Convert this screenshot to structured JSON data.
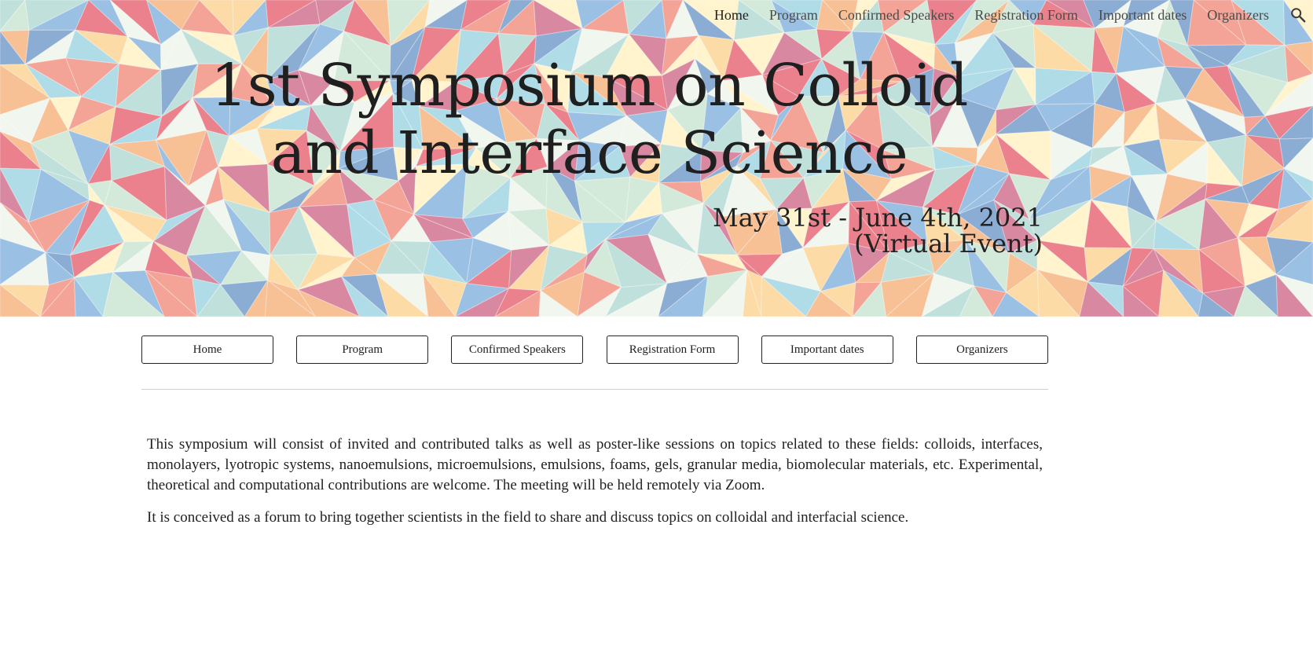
{
  "nav": {
    "links": [
      "Home",
      "Program",
      "Confirmed Speakers",
      "Registration Form",
      "Important dates",
      "Organizers"
    ],
    "active": "Home",
    "search_icon": "search-icon"
  },
  "hero": {
    "title_line1": "1st Symposium on Colloid",
    "title_line2": "and Interface Science",
    "dates_line1": "May 31st - June 4th, 2021",
    "dates_line2": "(Virtual Event)",
    "palette": [
      "#e8737f",
      "#f29a8c",
      "#f7b98a",
      "#fcd79c",
      "#fff3c9",
      "#cfe8d6",
      "#a8d8e6",
      "#8fb9e0",
      "#7ea3cf",
      "#d47b96",
      "#f0f7ee",
      "#b9ddd9"
    ]
  },
  "buttons": [
    "Home",
    "Program",
    "Confirmed Speakers",
    "Registration Form",
    "Important dates",
    "Organizers"
  ],
  "content": {
    "paragraph1": "This symposium will consist of invited and contributed talks as well as poster-like sessions on topics related to these fields: colloids, interfaces, monolayers, lyotropic systems, nanoemulsions, microemulsions, emulsions, foams, gels, granular media, biomolecular materials, etc. Experimental, theoretical and computational contributions are welcome. The meeting will be held remotely via Zoom.",
    "paragraph2": "It is conceived as a forum to bring together scientists in the field to share and discuss topics on colloidal and interfacial science."
  }
}
